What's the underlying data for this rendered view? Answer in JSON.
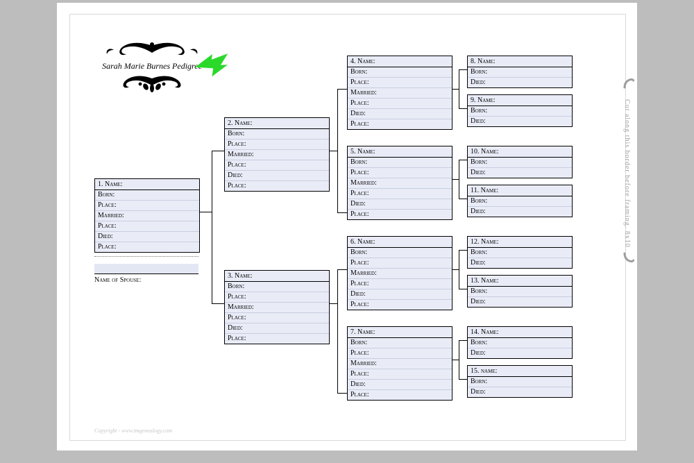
{
  "title": "Sarah Marie Burnes Pedigree",
  "copyright": "Copyright - www.tmgenealogy.com",
  "cut_text": "Cut along this border before framing. 8x10",
  "spouse_label": "Name of Spouse:",
  "fields6": [
    "Born:",
    "Place:",
    "Married:",
    "Place:",
    "Died:",
    "Place:"
  ],
  "fields2": [
    "Born:",
    "Died:"
  ],
  "p1": {
    "hd": "1. Name:"
  },
  "p2": {
    "hd": "2. Name:"
  },
  "p3": {
    "hd": "3. Name:"
  },
  "p4": {
    "hd": "4. Name:"
  },
  "p5": {
    "hd": "5. Name:"
  },
  "p6": {
    "hd": "6. Name:"
  },
  "p7": {
    "hd": "7. Name:"
  },
  "p8": {
    "hd": "8. Name:"
  },
  "p9": {
    "hd": "9. Name:"
  },
  "p10": {
    "hd": "10. Name:"
  },
  "p11": {
    "hd": "11. Name:"
  },
  "p12": {
    "hd": "12. Name:"
  },
  "p13": {
    "hd": "13. Name:"
  },
  "p14": {
    "hd": "14. Name:"
  },
  "p15": {
    "hd": "15. name:"
  }
}
